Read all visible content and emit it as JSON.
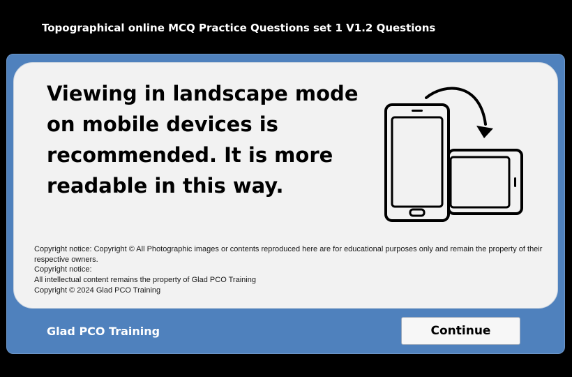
{
  "window": {
    "title": "Topographical online MCQ Practice Questions set 1 V1.2 Questions"
  },
  "notice": {
    "headline": "Viewing in landscape mode on mobile devices is recommended. It is more readable in this way.",
    "illustration_icon": "rotate-phone-icon",
    "copyright_lines": [
      "Copyright notice: Copyright © All Photographic images or contents reproduced here are for educational purposes only and remain the property of their respective owners.",
      "Copyright notice:",
      "All intellectual content remains the property of Glad PCO Training",
      "Copyright © 2024 Glad PCO Training"
    ]
  },
  "footer": {
    "brand": "Glad PCO Training",
    "continue_label": "Continue"
  },
  "colors": {
    "background": "#000000",
    "frame_blue": "#4f81bd",
    "card": "#f2f2f2"
  }
}
